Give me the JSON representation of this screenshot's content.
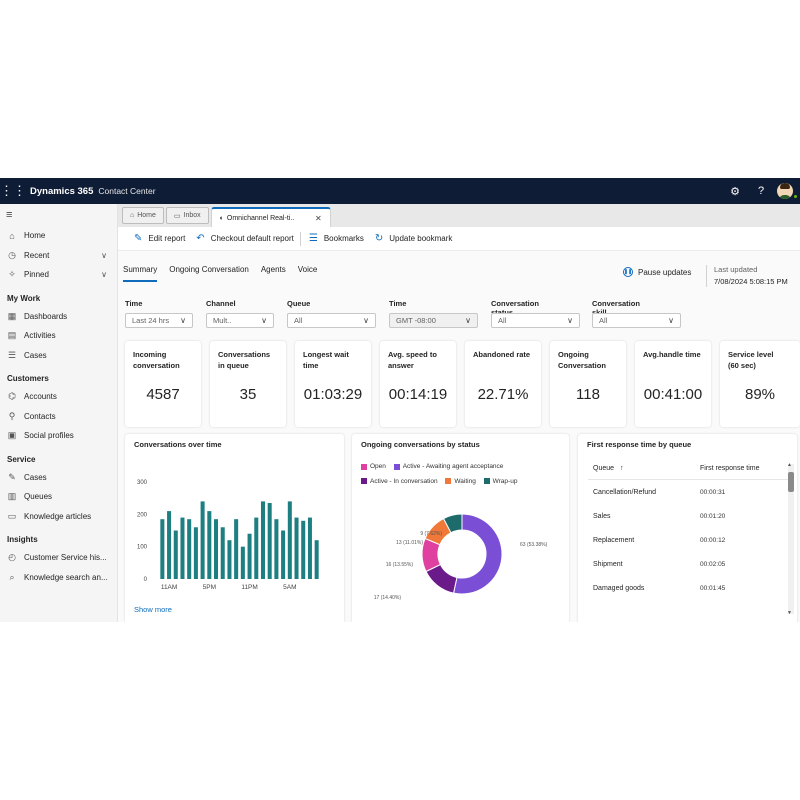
{
  "topbar": {
    "app_name": "Dynamics 365",
    "app_sub": "Contact Center"
  },
  "sidebar": {
    "top_items": [
      {
        "label": "Home",
        "icon": "home-icon"
      },
      {
        "label": "Recent",
        "icon": "clock-icon"
      },
      {
        "label": "Pinned",
        "icon": "pin-icon"
      }
    ],
    "sections": [
      {
        "title": "My Work",
        "items": [
          "Dashboards",
          "Activities",
          "Cases"
        ]
      },
      {
        "title": "Customers",
        "items": [
          "Accounts",
          "Contacts",
          "Social profiles"
        ]
      },
      {
        "title": "Service",
        "items": [
          "Cases",
          "Queues",
          "Knowledge articles"
        ]
      },
      {
        "title": "Insights",
        "items": [
          "Customer Service his...",
          "Knowledge search an..."
        ]
      }
    ]
  },
  "tabs": [
    {
      "label": "Home"
    },
    {
      "label": "Inbox"
    },
    {
      "label": "Omnichannel Real-ti.."
    }
  ],
  "commands": {
    "edit": "Edit report",
    "checkout": "Checkout default report",
    "bookmarks": "Bookmarks",
    "update": "Update bookmark"
  },
  "subtabs": [
    "Summary",
    "Ongoing Conversation",
    "Agents",
    "Voice"
  ],
  "pause_label": "Pause updates",
  "last_updated": {
    "label": "Last updated",
    "value": "7/08/2024 5:08:15 PM"
  },
  "filters": [
    {
      "label": "Time",
      "value": "Last 24 hrs"
    },
    {
      "label": "Channel",
      "value": "Mult.."
    },
    {
      "label": "Queue",
      "value": "All"
    },
    {
      "label": "Time",
      "value": "GMT -08:00"
    },
    {
      "label": "Conversation status",
      "value": "All"
    },
    {
      "label": "Conversation skill",
      "value": "All"
    }
  ],
  "kpis": [
    {
      "title": "Incoming conversation",
      "value": "4587"
    },
    {
      "title": "Conversations in queue",
      "value": "35"
    },
    {
      "title": "Longest wait time",
      "value": "01:03:29"
    },
    {
      "title": "Avg. speed to answer",
      "value": "00:14:19"
    },
    {
      "title": "Abandoned rate",
      "value": "22.71%"
    },
    {
      "title": "Ongoing Conversation",
      "value": "118"
    },
    {
      "title": "Avg.handle time",
      "value": "00:41:00"
    },
    {
      "title": "Service level (60 sec)",
      "value": "89%"
    }
  ],
  "cards": {
    "over_time_title": "Conversations over time",
    "show_more": "Show more",
    "status_title": "Ongoing conversations by status",
    "queue_title": "First response time by queue"
  },
  "colors": {
    "accent": "#0f6cbd",
    "bar": "#1e7f82",
    "topbar": "#0f1c36"
  },
  "chart_data": [
    {
      "type": "bar",
      "title": "Conversations over time",
      "x_tick_labels": [
        "11AM",
        "5PM",
        "11PM",
        "5AM"
      ],
      "y_ticks": [
        0,
        100,
        200,
        300
      ],
      "ylim": [
        0,
        300
      ],
      "values": [
        185,
        210,
        150,
        190,
        185,
        160,
        240,
        210,
        185,
        160,
        120,
        185,
        100,
        140,
        190,
        240,
        235,
        185,
        150,
        240,
        190,
        180,
        190,
        120
      ]
    },
    {
      "type": "pie",
      "title": "Ongoing conversations by status",
      "series": [
        {
          "name": "Active - Awaiting agent acceptance",
          "value": 63,
          "label": "63 (53.38%)",
          "color": "#7a4fd6"
        },
        {
          "name": "Active - In conversation",
          "value": 17,
          "label": "17 (14.40%)",
          "color": "#6b1a8a"
        },
        {
          "name": "Open",
          "value": 16,
          "label": "16 (13.55%)",
          "color": "#e040a0"
        },
        {
          "name": "Waiting",
          "value": 13,
          "label": "13 (11.01%)",
          "color": "#f07838"
        },
        {
          "name": "Wrap-up",
          "value": 9,
          "label": "9 (7.62%)",
          "color": "#1e6b6b"
        }
      ]
    },
    {
      "type": "table",
      "title": "First response time by queue",
      "columns": [
        "Queue",
        "First response time"
      ],
      "rows": [
        [
          "Cancellation/Refund",
          "00:00:31"
        ],
        [
          "Sales",
          "00:01:20"
        ],
        [
          "Replacement",
          "00:00:12"
        ],
        [
          "Shipment",
          "00:02:05"
        ],
        [
          "Damaged goods",
          "00:01:45"
        ]
      ]
    }
  ]
}
